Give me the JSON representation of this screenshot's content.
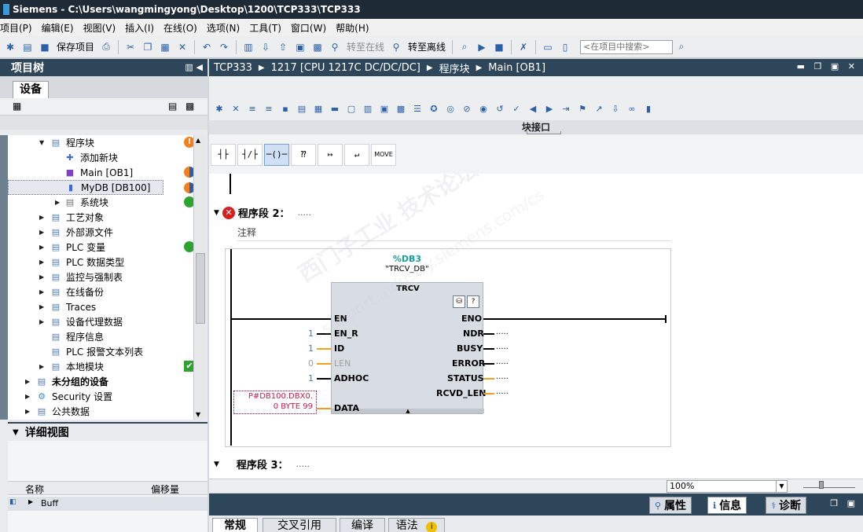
{
  "window": {
    "title": "Siemens  -  C:\\Users\\wangmingyong\\Desktop\\1200\\TCP333\\TCP333"
  },
  "menu": [
    "项目(P)",
    "编辑(E)",
    "视图(V)",
    "插入(I)",
    "在线(O)",
    "选项(N)",
    "工具(T)",
    "窗口(W)",
    "帮助(H)"
  ],
  "toolbar": {
    "save_project": "保存项目",
    "go_online": "转至在线",
    "go_offline": "转至离线",
    "search_placeholder": "<在项目中搜索>"
  },
  "project_tree": {
    "title": "项目树",
    "tab_devices": "设备",
    "items": [
      {
        "label": "程序块",
        "status": "warn"
      },
      {
        "label": "添加新块",
        "status": ""
      },
      {
        "label": "Main [OB1]",
        "status": "half"
      },
      {
        "label": "MyDB [DB100]",
        "status": "half"
      },
      {
        "label": "系统块",
        "status": "green"
      },
      {
        "label": "工艺对象",
        "status": ""
      },
      {
        "label": "外部源文件",
        "status": ""
      },
      {
        "label": "PLC 变量",
        "status": "green"
      },
      {
        "label": "PLC 数据类型",
        "status": ""
      },
      {
        "label": "监控与强制表",
        "status": ""
      },
      {
        "label": "在线备份",
        "status": ""
      },
      {
        "label": "Traces",
        "status": ""
      },
      {
        "label": "设备代理数据",
        "status": ""
      },
      {
        "label": "程序信息",
        "status": ""
      },
      {
        "label": "PLC 报警文本列表",
        "status": ""
      },
      {
        "label": "本地模块",
        "status": "check"
      },
      {
        "label": "未分组的设备",
        "status": ""
      },
      {
        "label": "Security 设置",
        "status": ""
      },
      {
        "label": "公共数据",
        "status": ""
      }
    ]
  },
  "detail_view": {
    "title": "详细视图",
    "col_name": "名称",
    "col_offset": "偏移量",
    "row_label": "Buff"
  },
  "breadcrumb": [
    "TCP333",
    "1217 [CPU 1217C DC/DC/DC]",
    "程序块",
    "Main [OB1]"
  ],
  "editor": {
    "interface_label": "块接口",
    "move_btn": "MOVE",
    "network2_title": "程序段 2：",
    "network3_title": "程序段 3：",
    "dots": ".....",
    "comment_label": "注释",
    "block": {
      "db_name": "%DB3",
      "db_symbol": "\"TRCV_DB\"",
      "type": "TRCV",
      "in_pins": [
        "EN",
        "EN_R",
        "ID",
        "LEN",
        "ADHOC",
        "DATA"
      ],
      "in_values": [
        "",
        "1",
        "1",
        "0",
        "1",
        ""
      ],
      "out_pins": [
        "ENO",
        "NDR",
        "BUSY",
        "ERROR",
        "STATUS",
        "RCVD_LEN"
      ],
      "data_param_line1": "P#DB100.DBX0.",
      "data_param_line2": "0 BYTE 99"
    }
  },
  "watermark": {
    "line1": "西门子工业  技术论坛",
    "line2": "support.industry.siemens.com/cs"
  },
  "zoom": {
    "value": "100%"
  },
  "inspector": {
    "tabs": [
      "属性",
      "信息",
      "诊断"
    ],
    "subtabs": [
      "常规",
      "交叉引用",
      "编译",
      "语法"
    ]
  }
}
